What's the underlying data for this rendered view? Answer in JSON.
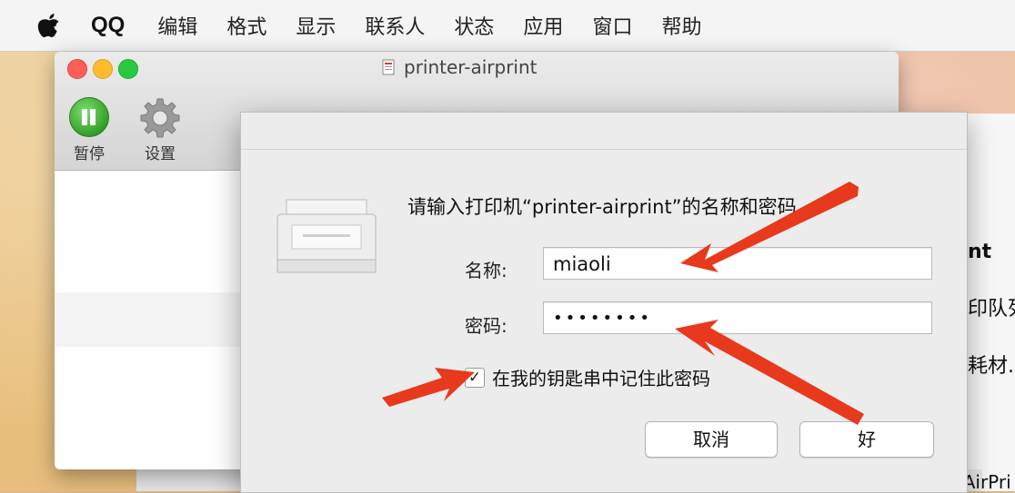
{
  "menubar": {
    "app_name": "QQ",
    "items": [
      "编辑",
      "格式",
      "显示",
      "联系人",
      "状态",
      "应用",
      "窗口",
      "帮助"
    ]
  },
  "window": {
    "title": "printer-airprint",
    "toolbar": {
      "pause_label": "暂停",
      "settings_label": "设置"
    }
  },
  "right_panel": {
    "line1": "nt",
    "line2": "印队列",
    "line3": "耗材.",
    "bottom": "Printer Airprint AirPri"
  },
  "dialog": {
    "prompt": "请输入打印机“printer-airprint”的名称和密码。",
    "name_label": "名称:",
    "name_value": "miaoli",
    "password_label": "密码:",
    "password_value": "••••••••",
    "remember_label": "在我的钥匙串中记住此密码",
    "remember_checked": true,
    "cancel_label": "取消",
    "ok_label": "好"
  },
  "colors": {
    "annotation_arrow": "#e8391c",
    "pause_green": "#2f9a25"
  }
}
